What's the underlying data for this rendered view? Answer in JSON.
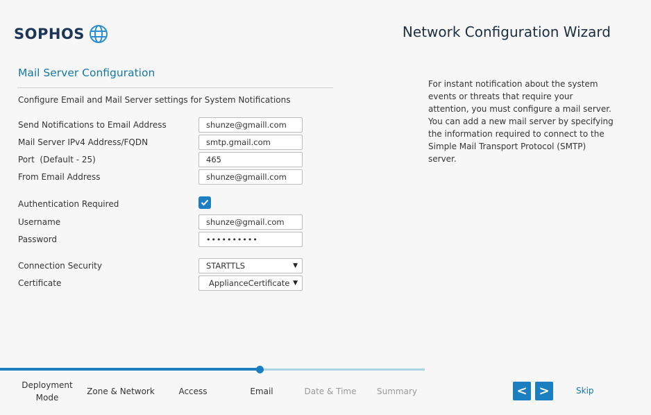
{
  "brand": {
    "name": "SOPHOS",
    "icon": "globe-icon"
  },
  "header": {
    "title": "Network Configuration Wizard"
  },
  "section": {
    "title": "Mail Server Configuration",
    "intro": "Configure Email and Mail Server settings for System Notifications"
  },
  "form": {
    "notify_email": {
      "label": "Send Notifications to Email Address",
      "value": "shunze@gmaill.com"
    },
    "mail_server": {
      "label": "Mail Server IPv4 Address/FQDN",
      "value": "smtp.gmail.com"
    },
    "port": {
      "label": "Port  (Default - 25)",
      "value": "465"
    },
    "from_email": {
      "label": "From Email Address",
      "value": "shunze@gmaill.com"
    },
    "auth_required": {
      "label": "Authentication Required",
      "checked": true
    },
    "username": {
      "label": "Username",
      "value": "shunze@gmail.com"
    },
    "password": {
      "label": "Password",
      "value": "••••••••••"
    },
    "connection_security": {
      "label": "Connection Security",
      "value": "STARTTLS"
    },
    "certificate": {
      "label": "Certificate",
      "value": "ApplianceCertificate"
    }
  },
  "help_text": "For instant notification about the system events or threats that require your attention, you must configure a mail server. You can add a new mail server by specifying the information required to connect to the Simple Mail Transport Protocol (SMTP) server.",
  "progress": {
    "current_step": "Email",
    "steps": [
      {
        "label_line1": "Deployment",
        "label_line2": "Mode"
      },
      {
        "label": "Zone & Network"
      },
      {
        "label": "Access"
      },
      {
        "label": "Email"
      },
      {
        "label": "Date & Time"
      },
      {
        "label": "Summary"
      }
    ]
  },
  "nav": {
    "prev": "<",
    "next": ">",
    "skip": "Skip"
  },
  "colors": {
    "accent": "#1b7ec0",
    "title": "#1478a6",
    "track": "#a9d3e7"
  }
}
